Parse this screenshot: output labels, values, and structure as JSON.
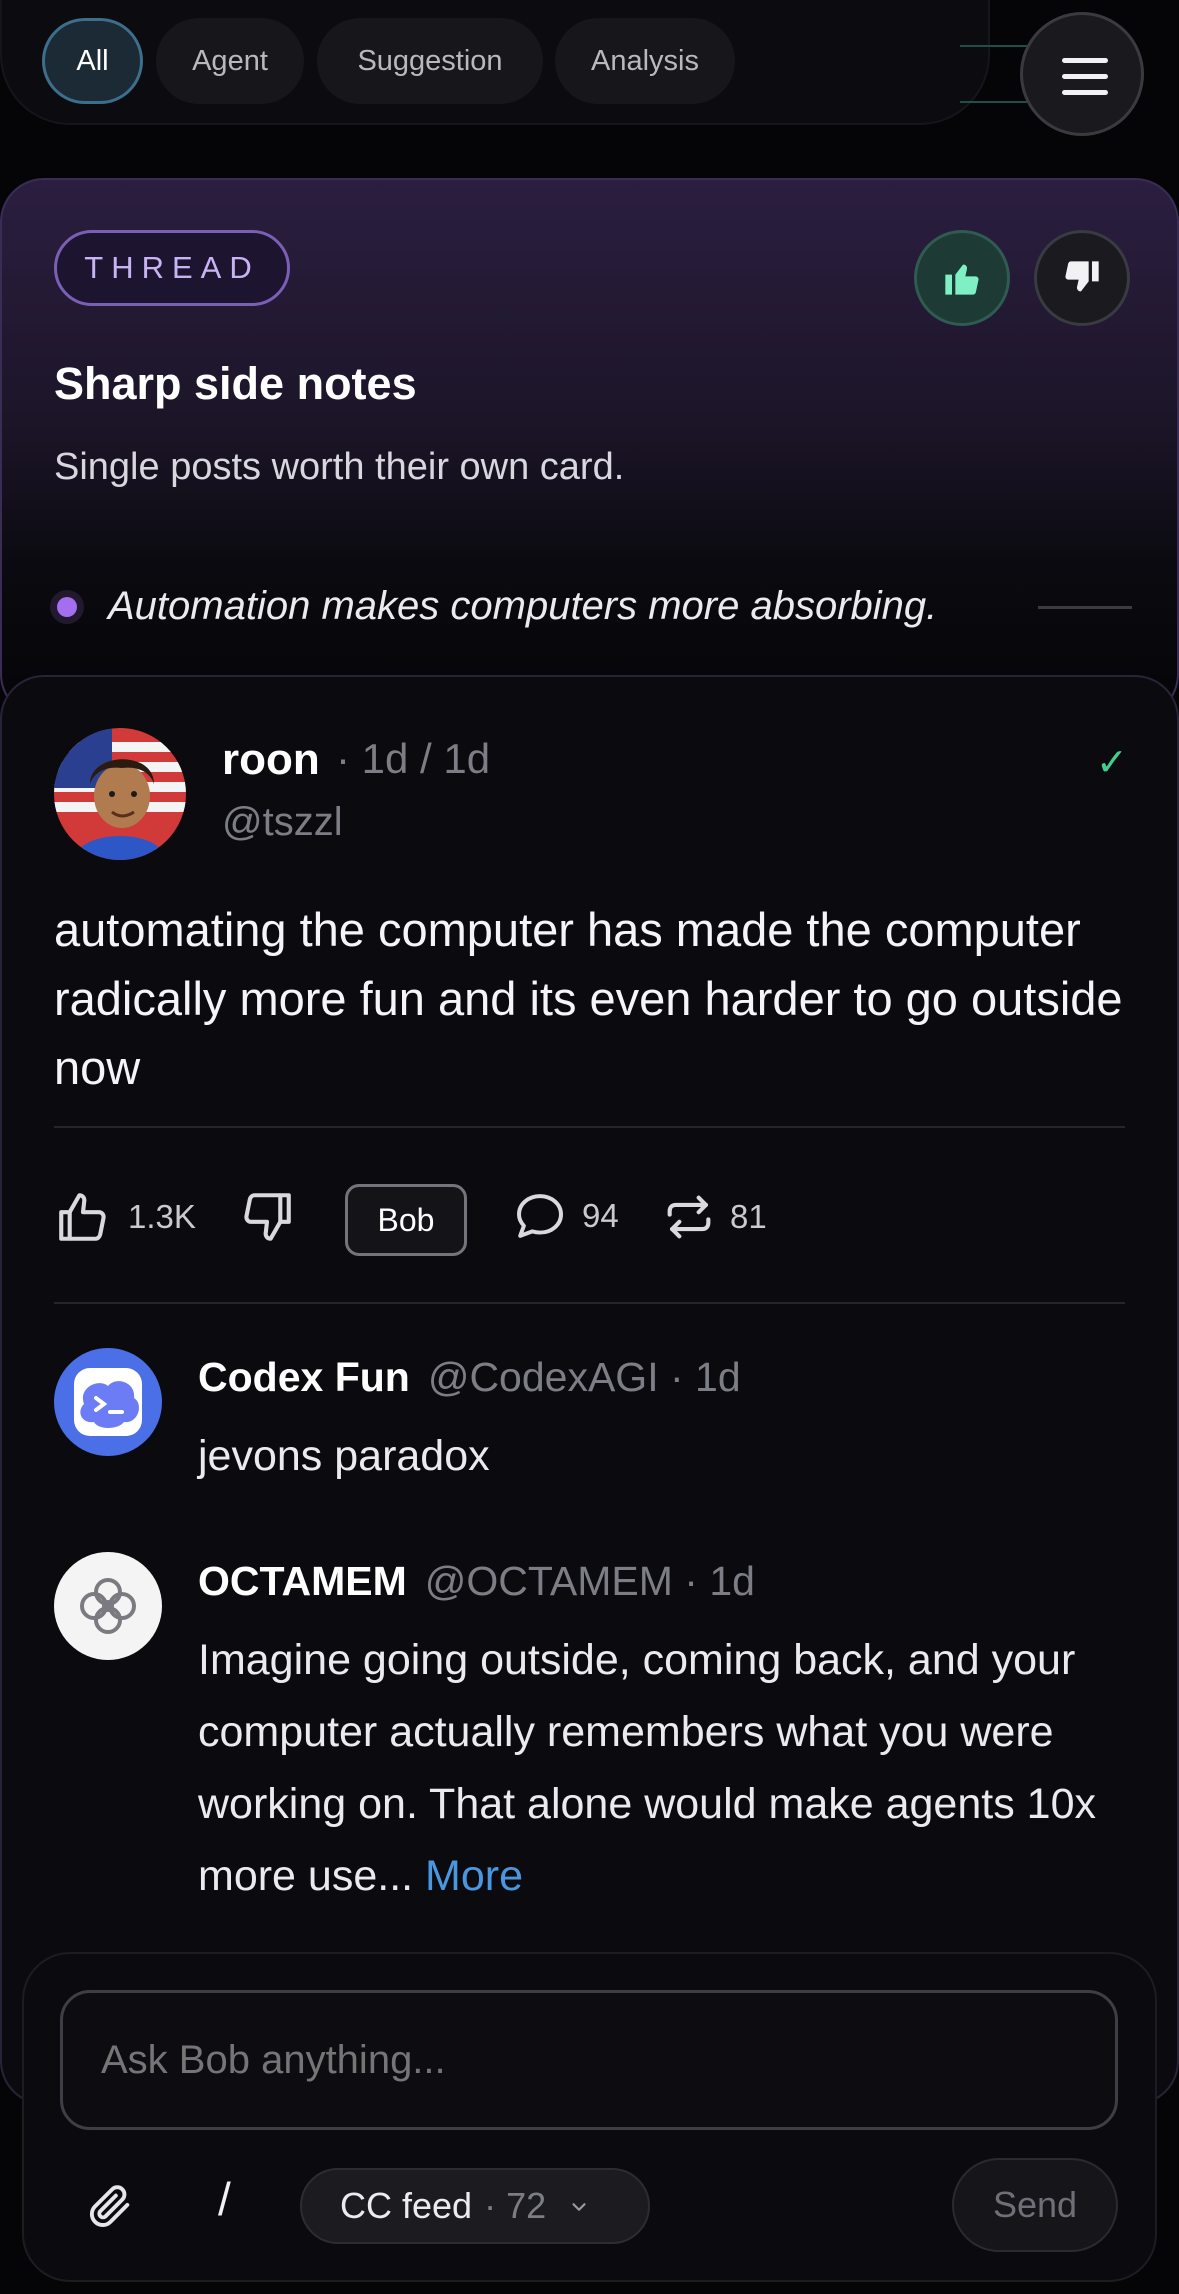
{
  "filters": {
    "chips": [
      {
        "label": "All",
        "active": true
      },
      {
        "label": "Agent",
        "active": false
      },
      {
        "label": "Suggestion",
        "active": false
      },
      {
        "label": "Analysis",
        "active": false
      }
    ],
    "menu_icon": "hamburger-menu-icon"
  },
  "thread": {
    "badge": "THREAD",
    "title": "Sharp side notes",
    "subtitle": "Single posts worth their own card.",
    "insight": "Automation makes computers more absorbing.",
    "vote_icons": [
      "thumbs-up-icon",
      "thumbs-down-icon"
    ]
  },
  "post": {
    "author_name": "roon",
    "time": "· 1d / 1d",
    "handle": "@tszzl",
    "verified_mark": "✓",
    "text": "automating the computer has made the computer radically more fun and its even harder to go outside now",
    "actions": {
      "likes": "1.3K",
      "bob_label": "Bob",
      "comments": "94",
      "reposts": "81"
    }
  },
  "replies": [
    {
      "name": "Codex Fun",
      "handle": "@CodexAGI",
      "time": " · 1d",
      "text": "jevons paradox",
      "more": ""
    },
    {
      "name": "OCTAMEM",
      "handle": "@OCTAMEM",
      "time": " · 1d",
      "text": "Imagine going outside, coming back, and your computer actually remembers what you were working on. That alone would make agents 10x more use...",
      "more": "More"
    }
  ],
  "composer": {
    "placeholder": "Ask Bob anything...",
    "slash": "/",
    "feed_label": "CC feed",
    "feed_count": "· 72",
    "send_label": "Send"
  },
  "colors": {
    "accent_purple": "#a46ef0",
    "accent_teal": "#3fd08f",
    "link_blue": "#4a97e0",
    "background": "#050507"
  }
}
